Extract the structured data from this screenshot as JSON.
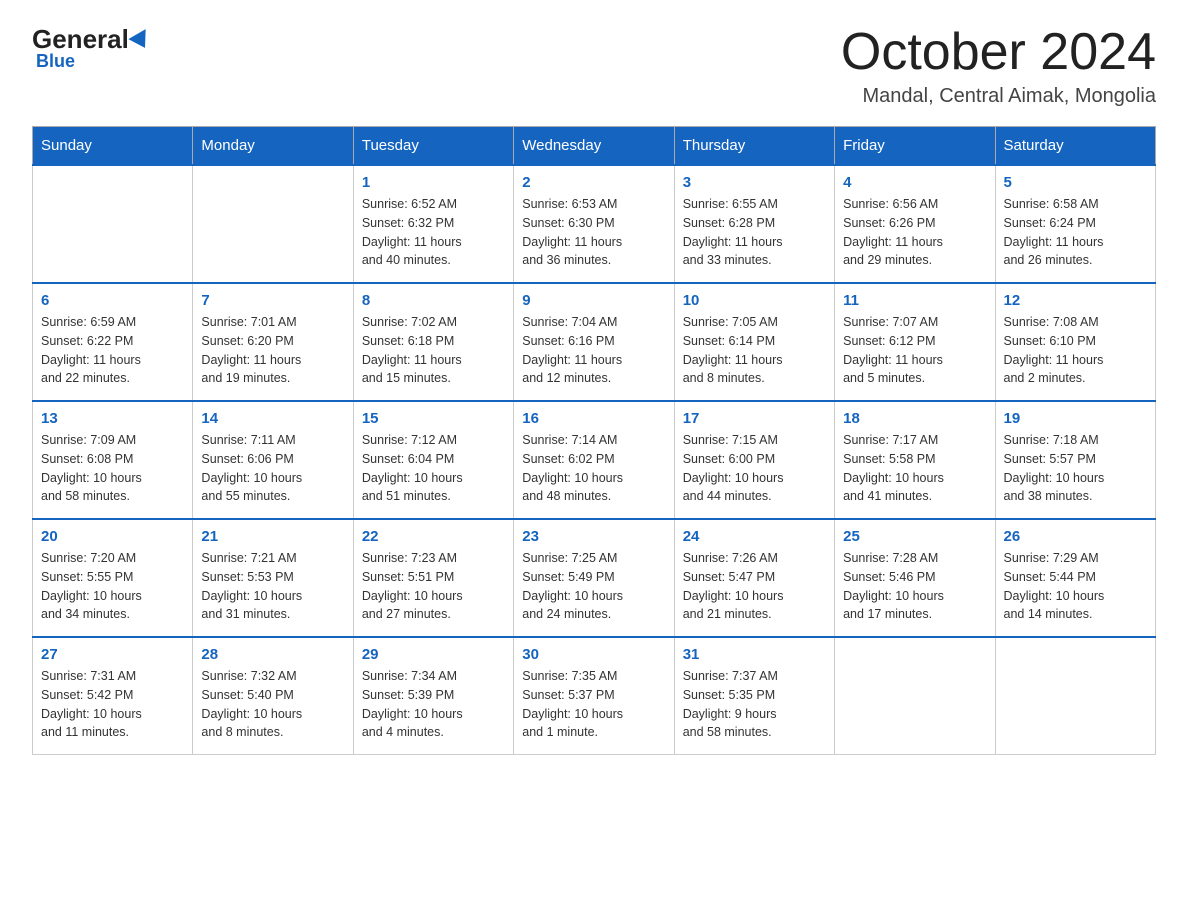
{
  "header": {
    "logo_general": "General",
    "logo_blue": "Blue",
    "month_title": "October 2024",
    "location": "Mandal, Central Aimak, Mongolia"
  },
  "days_of_week": [
    "Sunday",
    "Monday",
    "Tuesday",
    "Wednesday",
    "Thursday",
    "Friday",
    "Saturday"
  ],
  "weeks": [
    [
      {
        "day": "",
        "info": ""
      },
      {
        "day": "",
        "info": ""
      },
      {
        "day": "1",
        "info": "Sunrise: 6:52 AM\nSunset: 6:32 PM\nDaylight: 11 hours\nand 40 minutes."
      },
      {
        "day": "2",
        "info": "Sunrise: 6:53 AM\nSunset: 6:30 PM\nDaylight: 11 hours\nand 36 minutes."
      },
      {
        "day": "3",
        "info": "Sunrise: 6:55 AM\nSunset: 6:28 PM\nDaylight: 11 hours\nand 33 minutes."
      },
      {
        "day": "4",
        "info": "Sunrise: 6:56 AM\nSunset: 6:26 PM\nDaylight: 11 hours\nand 29 minutes."
      },
      {
        "day": "5",
        "info": "Sunrise: 6:58 AM\nSunset: 6:24 PM\nDaylight: 11 hours\nand 26 minutes."
      }
    ],
    [
      {
        "day": "6",
        "info": "Sunrise: 6:59 AM\nSunset: 6:22 PM\nDaylight: 11 hours\nand 22 minutes."
      },
      {
        "day": "7",
        "info": "Sunrise: 7:01 AM\nSunset: 6:20 PM\nDaylight: 11 hours\nand 19 minutes."
      },
      {
        "day": "8",
        "info": "Sunrise: 7:02 AM\nSunset: 6:18 PM\nDaylight: 11 hours\nand 15 minutes."
      },
      {
        "day": "9",
        "info": "Sunrise: 7:04 AM\nSunset: 6:16 PM\nDaylight: 11 hours\nand 12 minutes."
      },
      {
        "day": "10",
        "info": "Sunrise: 7:05 AM\nSunset: 6:14 PM\nDaylight: 11 hours\nand 8 minutes."
      },
      {
        "day": "11",
        "info": "Sunrise: 7:07 AM\nSunset: 6:12 PM\nDaylight: 11 hours\nand 5 minutes."
      },
      {
        "day": "12",
        "info": "Sunrise: 7:08 AM\nSunset: 6:10 PM\nDaylight: 11 hours\nand 2 minutes."
      }
    ],
    [
      {
        "day": "13",
        "info": "Sunrise: 7:09 AM\nSunset: 6:08 PM\nDaylight: 10 hours\nand 58 minutes."
      },
      {
        "day": "14",
        "info": "Sunrise: 7:11 AM\nSunset: 6:06 PM\nDaylight: 10 hours\nand 55 minutes."
      },
      {
        "day": "15",
        "info": "Sunrise: 7:12 AM\nSunset: 6:04 PM\nDaylight: 10 hours\nand 51 minutes."
      },
      {
        "day": "16",
        "info": "Sunrise: 7:14 AM\nSunset: 6:02 PM\nDaylight: 10 hours\nand 48 minutes."
      },
      {
        "day": "17",
        "info": "Sunrise: 7:15 AM\nSunset: 6:00 PM\nDaylight: 10 hours\nand 44 minutes."
      },
      {
        "day": "18",
        "info": "Sunrise: 7:17 AM\nSunset: 5:58 PM\nDaylight: 10 hours\nand 41 minutes."
      },
      {
        "day": "19",
        "info": "Sunrise: 7:18 AM\nSunset: 5:57 PM\nDaylight: 10 hours\nand 38 minutes."
      }
    ],
    [
      {
        "day": "20",
        "info": "Sunrise: 7:20 AM\nSunset: 5:55 PM\nDaylight: 10 hours\nand 34 minutes."
      },
      {
        "day": "21",
        "info": "Sunrise: 7:21 AM\nSunset: 5:53 PM\nDaylight: 10 hours\nand 31 minutes."
      },
      {
        "day": "22",
        "info": "Sunrise: 7:23 AM\nSunset: 5:51 PM\nDaylight: 10 hours\nand 27 minutes."
      },
      {
        "day": "23",
        "info": "Sunrise: 7:25 AM\nSunset: 5:49 PM\nDaylight: 10 hours\nand 24 minutes."
      },
      {
        "day": "24",
        "info": "Sunrise: 7:26 AM\nSunset: 5:47 PM\nDaylight: 10 hours\nand 21 minutes."
      },
      {
        "day": "25",
        "info": "Sunrise: 7:28 AM\nSunset: 5:46 PM\nDaylight: 10 hours\nand 17 minutes."
      },
      {
        "day": "26",
        "info": "Sunrise: 7:29 AM\nSunset: 5:44 PM\nDaylight: 10 hours\nand 14 minutes."
      }
    ],
    [
      {
        "day": "27",
        "info": "Sunrise: 7:31 AM\nSunset: 5:42 PM\nDaylight: 10 hours\nand 11 minutes."
      },
      {
        "day": "28",
        "info": "Sunrise: 7:32 AM\nSunset: 5:40 PM\nDaylight: 10 hours\nand 8 minutes."
      },
      {
        "day": "29",
        "info": "Sunrise: 7:34 AM\nSunset: 5:39 PM\nDaylight: 10 hours\nand 4 minutes."
      },
      {
        "day": "30",
        "info": "Sunrise: 7:35 AM\nSunset: 5:37 PM\nDaylight: 10 hours\nand 1 minute."
      },
      {
        "day": "31",
        "info": "Sunrise: 7:37 AM\nSunset: 5:35 PM\nDaylight: 9 hours\nand 58 minutes."
      },
      {
        "day": "",
        "info": ""
      },
      {
        "day": "",
        "info": ""
      }
    ]
  ]
}
